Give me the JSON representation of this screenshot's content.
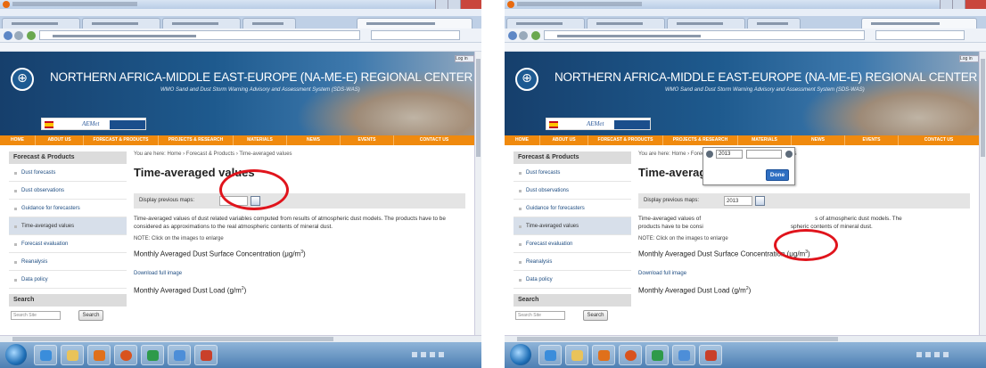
{
  "left": {
    "banner": {
      "title": "NORTHERN AFRICA-MIDDLE EAST-EUROPE (NA-ME-E) REGIONAL CENTER",
      "subtitle": "WMO Sand and Dust Storm Warning Advisory and Assessment System (SDS-WAS)",
      "aemet": "AEMet"
    },
    "login": "Log in",
    "nav": [
      "HOME",
      "ABOUT US",
      "FORECAST & PRODUCTS",
      "PROJECTS & RESEARCH",
      "MATERIALS",
      "NEWS",
      "EVENTS",
      "CONTACT US"
    ],
    "sidebar": {
      "heading": "Forecast & Products",
      "items": [
        "Dust forecasts",
        "Dust observations",
        "Guidance for forecasters",
        "Time-averaged values",
        "Forecast evaluation",
        "Reanalysis",
        "Data policy"
      ],
      "current_index": 3,
      "search_heading": "Search",
      "search_placeholder": "Search Site",
      "search_button": "Search"
    },
    "main": {
      "breadcrumb": "You are here: Home › Forecast & Products › Time-averaged values",
      "title": "Time-averaged values",
      "display_label": "Display previous maps:",
      "date_value": "",
      "para": "Time-averaged values of dust related variables computed from results of atmospheric dust models. The products have to be considered as approximations to the real atmospheric contents of mineral dust.",
      "note": "NOTE: Click on the images to enlarge",
      "section1": "Monthly Averaged Dust Surface Concentration (μg/m",
      "section1_sup": "3",
      "download": "Download full image",
      "section2": "Monthly Averaged Dust Load (g/m",
      "section2_sup": "2"
    }
  },
  "right": {
    "banner": {
      "title": "NORTHERN AFRICA-MIDDLE EAST-EUROPE (NA-ME-E) REGIONAL CENTER",
      "subtitle": "WMO Sand and Dust Storm Warning Advisory and Assessment System (SDS-WAS)",
      "aemet": "AEMet"
    },
    "login": "Log in",
    "nav": [
      "HOME",
      "ABOUT US",
      "FORECAST & PRODUCTS",
      "PROJECTS & RESEARCH",
      "MATERIALS",
      "NEWS",
      "EVENTS",
      "CONTACT US"
    ],
    "sidebar": {
      "heading": "Forecast & Products",
      "items": [
        "Dust forecasts",
        "Dust observations",
        "Guidance for forecasters",
        "Time-averaged values",
        "Forecast evaluation",
        "Reanalysis",
        "Data policy"
      ],
      "current_index": 3,
      "search_heading": "Search",
      "search_placeholder": "Search Site",
      "search_button": "Search"
    },
    "main": {
      "breadcrumb": "You are here: Home › Forecast & Products › Time-averaged values",
      "title": "Time-averaged values",
      "display_label": "Display previous maps:",
      "date_value": "2013",
      "para_start": "Time-averaged values of",
      "para_mid": "s of atmospheric dust models. The",
      "para_line2a": "products have to be consi",
      "para_line2b": "spheric contents of mineral dust.",
      "note": "NOTE: Click on the images to enlarge",
      "section1": "Monthly Averaged Dust Surface Concentration (μg/m",
      "section1_sup": "3",
      "download": "Download full image",
      "section2": "Monthly Averaged Dust Load (g/m",
      "section2_sup": "2"
    },
    "datepicker": {
      "year": "2013",
      "done": "Done"
    }
  },
  "colors": {
    "orange_nav": "#f08a0e",
    "banner_blue": "#1e5a8e",
    "annotation_red": "#e0141c",
    "done_blue": "#2f6fc2"
  }
}
